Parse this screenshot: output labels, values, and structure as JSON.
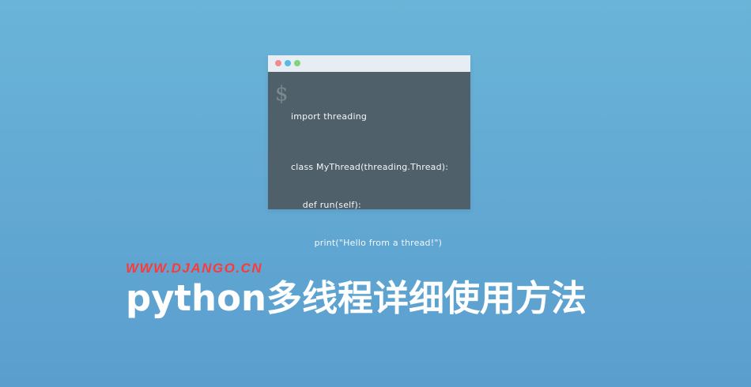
{
  "terminal": {
    "prompt_symbol": "$",
    "code_lines": [
      "import threading",
      "class MyThread(threading.Thread):",
      "    def run(self):",
      "        print(\"Hello from a thread!\")"
    ]
  },
  "site_url": "WWW.DJANGO.CN",
  "headline": "python多线程详细使用方法"
}
